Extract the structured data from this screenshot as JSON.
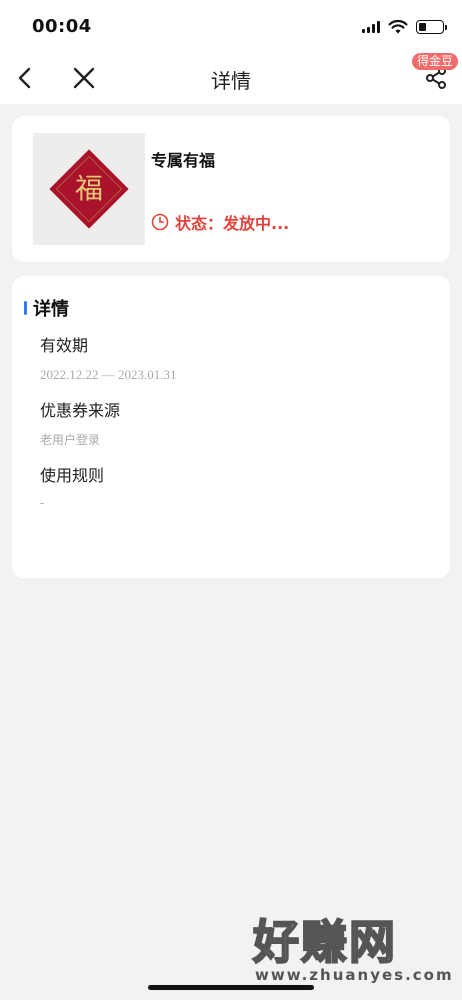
{
  "status_bar": {
    "time": "00:04"
  },
  "nav": {
    "title": "详情",
    "badge": "得金豆"
  },
  "coupon": {
    "title": "专属有福",
    "status": "状态：发放中...",
    "image_glyph": "福"
  },
  "details": {
    "section_title": "详情",
    "items": [
      {
        "label": "有效期",
        "value": "2022.12.22 — 2023.01.31"
      },
      {
        "label": "优惠券来源",
        "value": "老用户登录"
      },
      {
        "label": "使用规则",
        "value": "-"
      }
    ]
  },
  "watermark": {
    "brand": "好赚网",
    "url": "www.zhuanyes.com"
  },
  "colors": {
    "status_red": "#e0453b",
    "accent_blue": "#2f7cf6",
    "badge_red": "#f26b6b",
    "fu_red": "#a8122a"
  }
}
